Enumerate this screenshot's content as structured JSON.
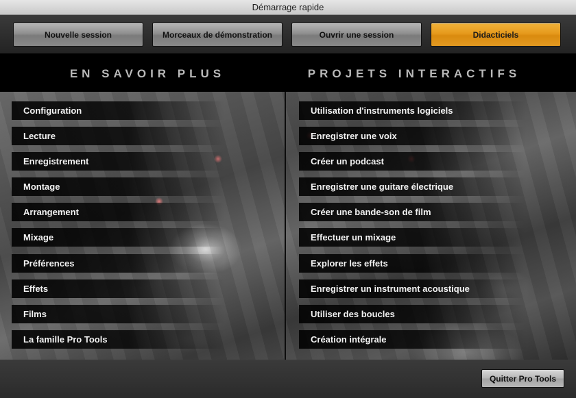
{
  "window": {
    "title": "Démarrage rapide"
  },
  "tabs": [
    {
      "label": "Nouvelle session",
      "active": false
    },
    {
      "label": "Morceaux de démonstration",
      "active": false
    },
    {
      "label": "Ouvrir une session",
      "active": false
    },
    {
      "label": "Didacticiels",
      "active": true
    }
  ],
  "left_column": {
    "heading": "EN SAVOIR PLUS",
    "items": [
      "Configuration",
      "Lecture",
      "Enregistrement",
      "Montage",
      "Arrangement",
      "Mixage",
      "Préférences",
      "Effets",
      "Films",
      "La famille Pro Tools"
    ]
  },
  "right_column": {
    "heading": "PROJETS INTERACTIFS",
    "items": [
      "Utilisation d'instruments logiciels",
      "Enregistrer une voix",
      "Créer un podcast",
      "Enregistrer une guitare électrique",
      "Créer une bande-son de film",
      "Effectuer un mixage",
      "Explorer les effets",
      "Enregistrer un instrument acoustique",
      "Utiliser des boucles",
      "Création intégrale"
    ]
  },
  "footer": {
    "quit_label": "Quitter Pro Tools"
  },
  "colors": {
    "accent": "#e69a1c",
    "panel_bg": "#000000",
    "item_text": "#f2f2f2",
    "heading_text": "#b9b9b9"
  }
}
